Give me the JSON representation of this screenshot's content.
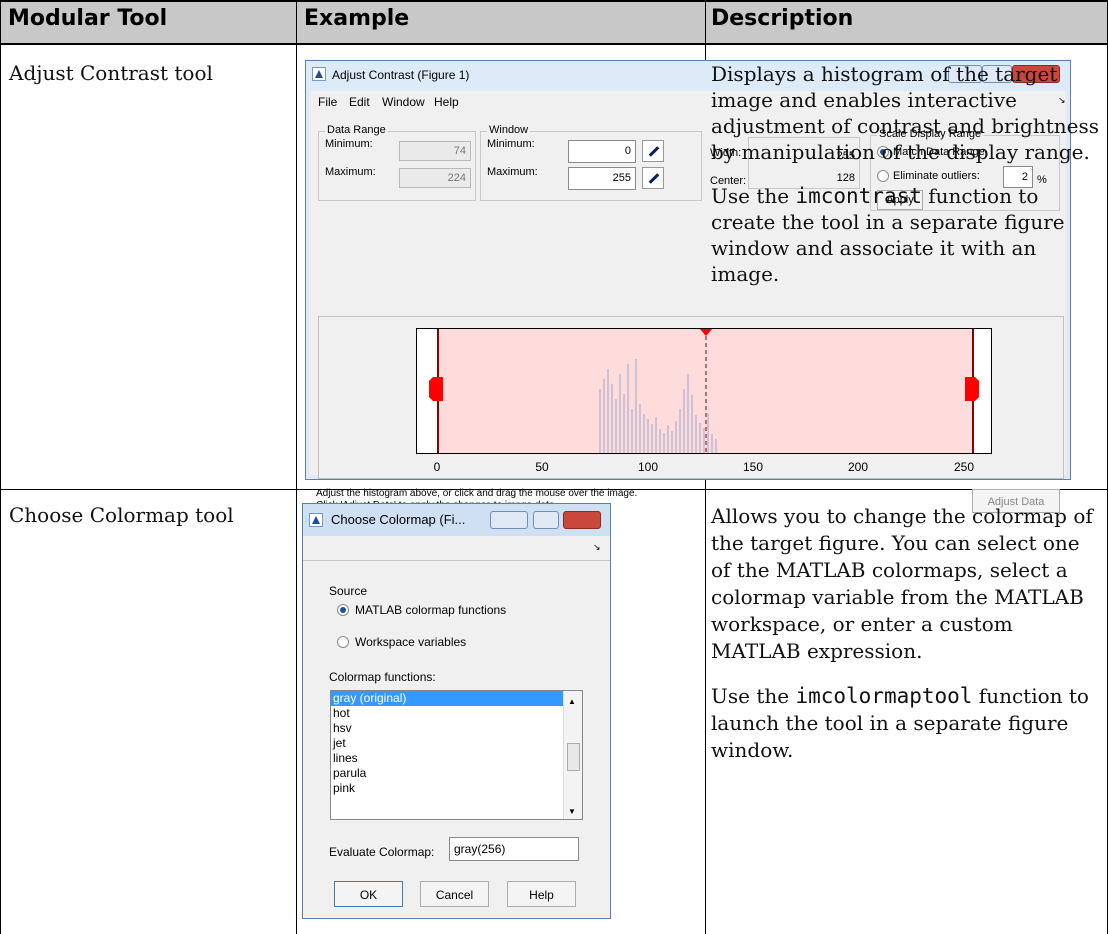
{
  "headers": {
    "col1": "Modular Tool",
    "col2": "Example",
    "col3": "Description"
  },
  "rows": [
    {
      "tool": "Adjust Contrast tool",
      "desc_p1": "Displays a histogram of the target image and enables interactive adjustment of contrast and brightness by manipulation of the display range.",
      "desc_p2_before": "Use the ",
      "desc_p2_code": "imcontrast",
      "desc_p2_after": " function to create the tool in a separate figure window and associate it with an image."
    },
    {
      "tool": "Choose Colormap tool",
      "desc_p1": "Allows you to change the colormap of the target figure. You can select one of the MATLAB colormaps, select a colormap variable from the MATLAB workspace, or enter a custom MATLAB expression.",
      "desc_p2_before": "Use the ",
      "desc_p2_code": "imcolormaptool",
      "desc_p2_after": " function to launch the tool in a separate figure window."
    }
  ],
  "contrast_window": {
    "title": "Adjust Contrast (Figure 1)",
    "menu": [
      "File",
      "Edit",
      "Window",
      "Help"
    ],
    "data_range_label": "Data Range",
    "minimum_label": "Minimum:",
    "maximum_label": "Maximum:",
    "data_min": "74",
    "data_max": "224",
    "window_label": "Window",
    "win_min": "0",
    "win_max": "255",
    "width_label": "Width:",
    "center_label": "Center:",
    "width_val": "255",
    "center_val": "128",
    "scale_label": "Scale Display Range",
    "match_label": "Match Data Range",
    "eliminate_label": "Eliminate outliers:",
    "outlier_val": "2",
    "percent": "%",
    "apply_label": "Apply",
    "ticks": [
      "0",
      "50",
      "100",
      "150",
      "200",
      "250"
    ],
    "hint_line1": "Adjust the histogram above, or click and drag the mouse over the image.",
    "hint_line2": "Click 'Adjust Data' to apply the changes to image data.",
    "adjust_data_label": "Adjust Data",
    "accent_color": "#ffdcdc",
    "marker_color": "#ff0000"
  },
  "colormap_window": {
    "title": "Choose Colormap (Fi...",
    "source_label": "Source",
    "opt1": "MATLAB colormap functions",
    "opt2": "Workspace variables",
    "functions_label": "Colormap functions:",
    "items": [
      "gray (original)",
      "hot",
      "hsv",
      "jet",
      "lines",
      "parula",
      "pink"
    ],
    "evaluate_label": "Evaluate Colormap:",
    "evaluate_value": "gray(256)",
    "ok_label": "OK",
    "cancel_label": "Cancel",
    "help_label": "Help",
    "select_color": "#3399ff"
  }
}
